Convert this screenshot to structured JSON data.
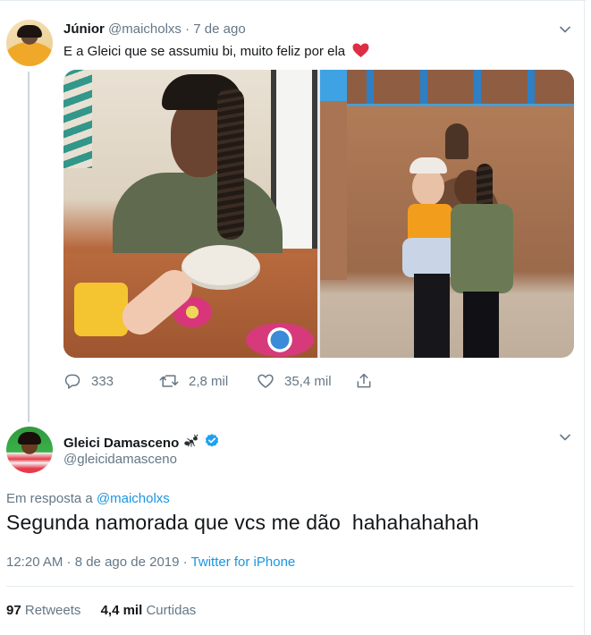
{
  "parent_tweet": {
    "display_name": "Júnior",
    "handle": "@maicholxs",
    "separator": "·",
    "time": "7 de ago",
    "text": "E a Gleici que se assumiu bi, muito feliz por ela",
    "emoji": "red-heart-icon",
    "media_count": 2,
    "actions": {
      "replies": "333",
      "retweets": "2,8 mil",
      "likes": "35,4 mil"
    }
  },
  "main_tweet": {
    "display_name": "Gleici Damasceno",
    "handle": "@gleicidamasceno",
    "name_emoji": "ant-icon",
    "verified": true,
    "reply_prefix": "Em resposta a ",
    "reply_to": "@maicholxs",
    "text": "Segunda namorada que vcs me dão  hahahahahah",
    "timestamp": "12:20 AM · 8 de ago de 2019 · ",
    "source": "Twitter for iPhone",
    "stats": {
      "retweets_count": "97",
      "retweets_label": "Retweets",
      "likes_count": "4,4 mil",
      "likes_label": "Curtidas"
    }
  },
  "colors": {
    "text": "#14171a",
    "secondary": "#657786",
    "link": "#1b95e0",
    "border": "#e6ecf0",
    "thread_line": "#ccd6dd",
    "heart": "#e0245e",
    "verified": "#1da1f2"
  }
}
